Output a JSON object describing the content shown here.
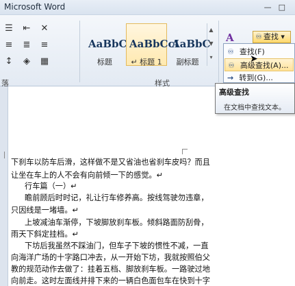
{
  "window": {
    "title": "Microsoft Word"
  },
  "ribbon": {
    "styles": [
      {
        "sample": "AaBbC",
        "name": "标题"
      },
      {
        "sample": "AaBbCcI",
        "name": "↵ 标题 1"
      },
      {
        "sample": "AaBbC",
        "name": "副标题"
      }
    ],
    "groups": {
      "paragraph_fragment": "落",
      "styles": "样式"
    },
    "find_button": {
      "label": "查找"
    }
  },
  "find_menu": {
    "items": [
      {
        "label": "查找(F)"
      },
      {
        "label": "高级查找(A)..."
      },
      {
        "label": "转到(G)..."
      }
    ]
  },
  "tooltip": {
    "title": "高级查找",
    "description": "在文档中查找文本。"
  },
  "document": {
    "lines": [
      "下刹车以防车后滑，这样做不是又省油也省刹车皮吗？而且",
      "让坐在车上的人不会有向前倾一下的感觉。↵",
      "行车篇（一）↵",
      "瞻前顾后时时记，礼让行车修养高。按线驾驶勿违章，",
      "只因线是一堵墙。↵",
      "上坡减油车渐停，下坡脚放刹车板。倾斜路面防刮骨，",
      "雨天下斜定挂档。↵",
      "下坊后我虽然不踩油门，但车子下坡的惯性不减，一直",
      "向海洋广场的十字路口冲去，从一开始下坊，我就按照伯父",
      "教的规范动作去做了：挂着五档、脚放刹车板。一路驶过地",
      "向前走。这时左面线并排下来的一辆白色面包车在快到十字"
    ]
  }
}
